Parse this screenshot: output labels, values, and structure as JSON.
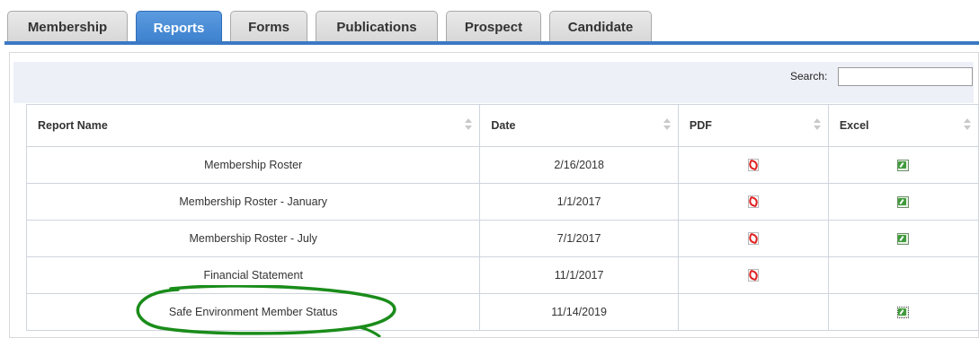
{
  "tabs": [
    {
      "label": "Membership"
    },
    {
      "label": "Reports"
    },
    {
      "label": "Forms"
    },
    {
      "label": "Publications"
    },
    {
      "label": "Prospect"
    },
    {
      "label": "Candidate"
    }
  ],
  "search": {
    "label": "Search:",
    "value": ""
  },
  "table": {
    "headers": [
      "Report Name",
      "Date",
      "PDF",
      "Excel"
    ],
    "rows": [
      {
        "name": "Membership Roster",
        "date": "2/16/2018",
        "pdf": "pdf-icon",
        "excel": "excel-icon"
      },
      {
        "name": "Membership Roster - January",
        "date": "1/1/2017",
        "pdf": "pdf-icon",
        "excel": "excel-icon"
      },
      {
        "name": "Membership Roster - July",
        "date": "7/1/2017",
        "pdf": "pdf-icon",
        "excel": "excel-icon"
      },
      {
        "name": "Financial Statement",
        "date": "11/1/2017",
        "pdf": "pdf-icon",
        "excel": ""
      },
      {
        "name": "Safe Environment Member Status",
        "date": "11/14/2019",
        "pdf": "",
        "excel": "excel-icon"
      }
    ]
  },
  "colors": {
    "active_tab": "#3b7fcc",
    "annotation": "#1a8c1a",
    "toolbar_bg": "#eef0f8"
  }
}
